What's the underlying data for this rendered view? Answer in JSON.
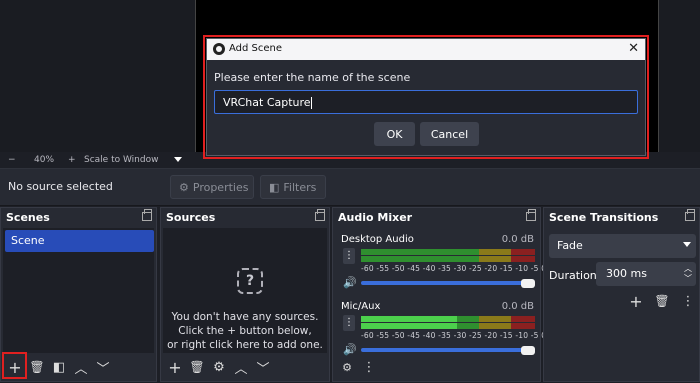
{
  "preview": {
    "zoom": "40%",
    "zoom_minus": "−",
    "zoom_plus": "+",
    "scale_mode": "Scale to Window"
  },
  "source_bar": {
    "no_source": "No source selected",
    "properties": "Properties",
    "filters": "Filters"
  },
  "scenes": {
    "title": "Scenes",
    "items": [
      "Scene"
    ]
  },
  "sources": {
    "title": "Sources",
    "empty_line1": "You don't have any sources.",
    "empty_line2": "Click the + button below,",
    "empty_line3": "or right click here to add one."
  },
  "mixer": {
    "title": "Audio Mixer",
    "channels": [
      {
        "name": "Desktop Audio",
        "db": "0.0 dB",
        "level": 0
      },
      {
        "name": "Mic/Aux",
        "db": "0.0 dB",
        "level": 0.55
      }
    ],
    "ticks": "-60 -55 -50 -45 -40 -35 -30 -25 -20 -15 -10 -5 0"
  },
  "transitions": {
    "title": "Scene Transitions",
    "selected": "Fade",
    "duration_label": "Duration",
    "duration_value": "300 ms"
  },
  "dialog": {
    "title": "Add Scene",
    "prompt": "Please enter the name of the scene",
    "value": "VRChat Capture",
    "ok": "OK",
    "cancel": "Cancel"
  },
  "icons": {
    "close": "✕",
    "plus": "+",
    "minus": "−"
  },
  "colors": {
    "accent": "#3a6edb",
    "highlight": "#e02020",
    "selected_scene": "#284cb8"
  }
}
